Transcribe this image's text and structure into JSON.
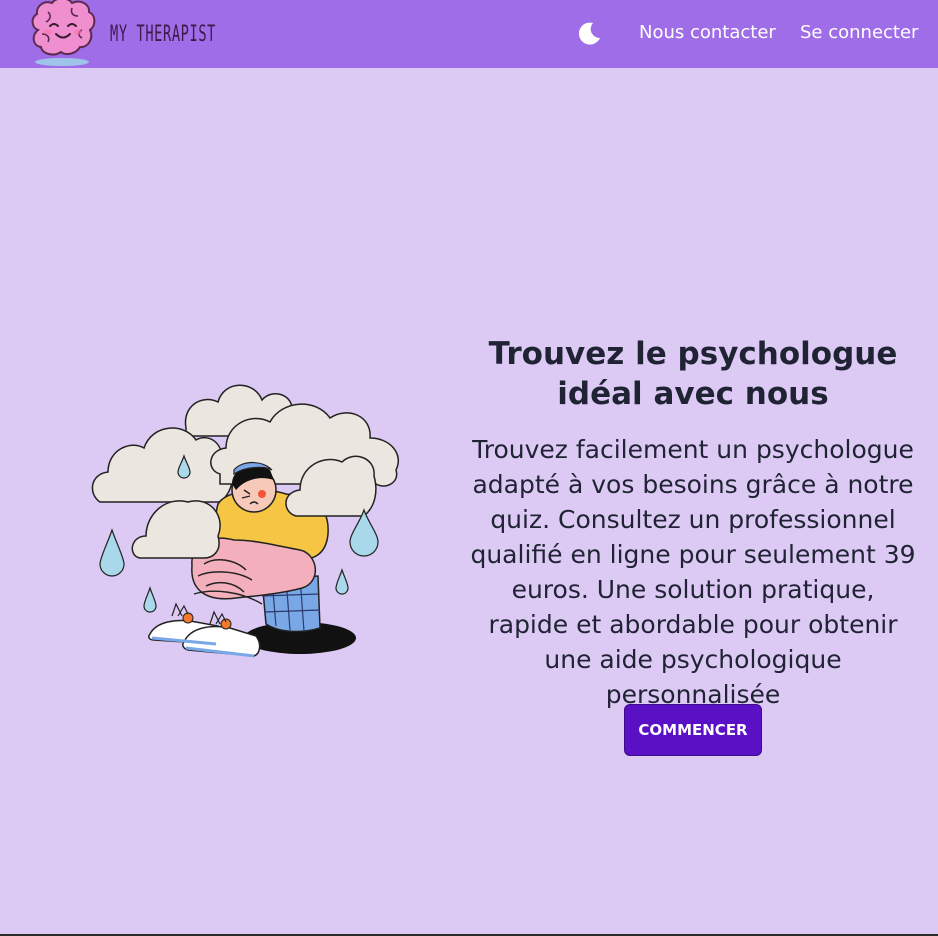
{
  "header": {
    "brand": "MY THERAPIST",
    "theme_toggle_icon": "moon-icon",
    "nav": {
      "contact": "Nous contacter",
      "login": "Se connecter"
    }
  },
  "hero": {
    "title": "Trouvez le psychologue idéal avec nous",
    "description": "Trouvez facilement un psychologue adapté à vos besoins grâce à notre quiz. Consultez un professionnel qualifié en ligne pour seulement 39 euros. Une solution pratique, rapide et abordable pour obtenir une aide psychologique personnalisée",
    "cta": "COMMENCER"
  },
  "colors": {
    "navbar": "#a06de8",
    "background": "#dcc9f4",
    "cta": "#5a10c4",
    "text": "#1f2333"
  }
}
